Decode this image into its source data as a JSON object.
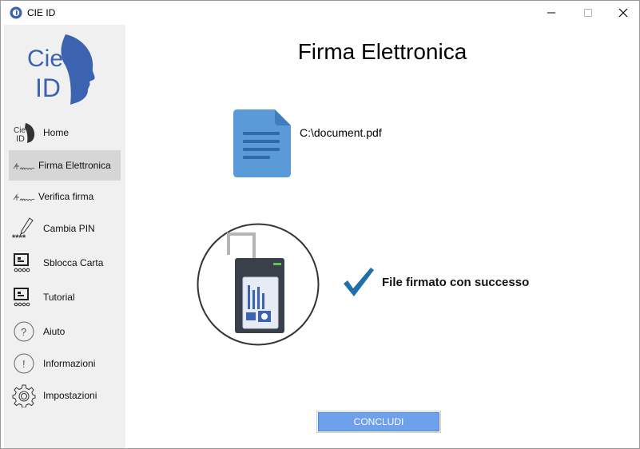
{
  "window": {
    "title": "CIE ID"
  },
  "sidebar": {
    "logo_text": "Cie ID",
    "items": [
      {
        "label": "Home",
        "icon": "cie-id-icon",
        "active": false
      },
      {
        "label": "Firma Elettronica",
        "icon": "signature-icon",
        "active": true
      },
      {
        "label": "Verifica firma",
        "icon": "signature-icon",
        "active": false
      },
      {
        "label": "Cambia PIN",
        "icon": "pen-pin-icon",
        "active": false
      },
      {
        "label": "Sblocca Carta",
        "icon": "card-unlock-icon",
        "active": false
      },
      {
        "label": "Tutorial",
        "icon": "tutorial-icon",
        "active": false
      },
      {
        "label": "Aiuto",
        "icon": "help-icon",
        "active": false
      },
      {
        "label": "Informazioni",
        "icon": "info-icon",
        "active": false
      },
      {
        "label": "Impostazioni",
        "icon": "gear-icon",
        "active": false
      }
    ]
  },
  "main": {
    "title": "Firma Elettronica",
    "file_path": "C:\\document.pdf",
    "status": "File firmato con successo",
    "button_label": "CONCLUDI"
  },
  "colors": {
    "accent": "#6fa1ea",
    "check": "#1f6fa8",
    "brand_blue": "#3b63b0",
    "doc_blue": "#5b9ad8"
  }
}
